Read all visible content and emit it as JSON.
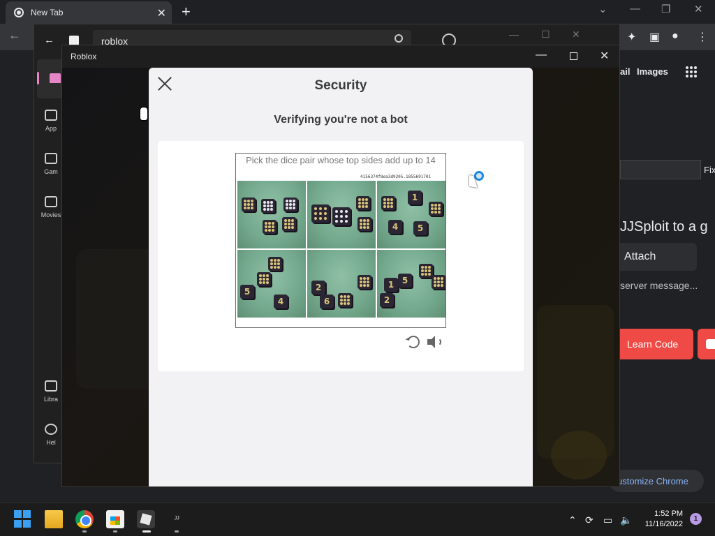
{
  "browser": {
    "tab_title": "New Tab",
    "new_tab_symbol": "+",
    "links": [
      "ail",
      "Images"
    ],
    "page_button_fix": "Fix",
    "page_heading": "JJSploit to a g",
    "attach_label": "Attach",
    "server_message": "server message...",
    "learn_code_label": "Learn Code",
    "customize_label": "ustomize Chrome"
  },
  "store": {
    "search_value": "roblox",
    "nav": [
      "App",
      "Gam",
      "Movies",
      "Libra",
      "Hel"
    ]
  },
  "roblox_window": {
    "title": "Roblox"
  },
  "security_modal": {
    "title": "Security",
    "subtitle": "Verifying you're not a bot",
    "captcha_prompt": "Pick the dice pair whose top sides add up to 14",
    "session_id": "4156374f8ea3d9205.1855691701"
  },
  "taskbar": {
    "time": "1:52 PM",
    "date": "11/16/2022",
    "notification_count": "1",
    "jj_label": "ᴶᴶ"
  },
  "colors": {
    "modal_bg": "#f2f2f4",
    "learn_code_red": "#ef4a45",
    "link_blue": "#8ab4f8",
    "store_accent": "#e685c8"
  }
}
